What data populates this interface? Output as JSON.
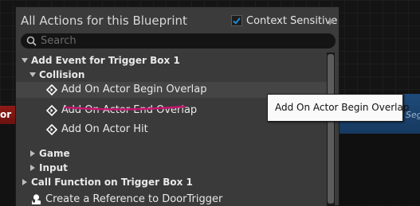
{
  "background_node_left": {
    "title": "or B"
  },
  "background_node_right": {
    "label": "Seg"
  },
  "menu": {
    "title": "All Actions for this Blueprint",
    "context_sensitive": {
      "label": "Context Sensitive",
      "checked": true
    },
    "search": {
      "placeholder": "Search",
      "value": ""
    },
    "tree": [
      {
        "kind": "category",
        "label": "Add Event for Trigger Box 1",
        "expanded": true,
        "level": 0
      },
      {
        "kind": "category",
        "label": "Collision",
        "expanded": true,
        "level": 1
      },
      {
        "kind": "event",
        "label": "Add On Actor Begin Overlap",
        "level": 2,
        "hovered": true
      },
      {
        "kind": "event",
        "label": "Add On Actor End Overlap",
        "level": 2
      },
      {
        "kind": "event",
        "label": "Add On Actor Hit",
        "level": 2
      },
      {
        "kind": "category",
        "label": "Game",
        "expanded": false,
        "level": 1
      },
      {
        "kind": "category",
        "label": "Input",
        "expanded": false,
        "level": 1
      },
      {
        "kind": "category",
        "label": "Call Function on Trigger Box 1",
        "expanded": false,
        "level": 0
      },
      {
        "kind": "action",
        "label": "Create a Reference to DoorTrigger",
        "level": 0
      }
    ]
  },
  "tooltip": {
    "text": "Add On Actor Begin Overlap"
  },
  "colors": {
    "annotation_underline": "#c4166e",
    "checkbox_check": "#1e8ad6",
    "node_red": "#8e1a16",
    "node_blue": "#1f4a7a"
  },
  "icons": {
    "search": "search-icon",
    "event": "event-diamond-icon",
    "reference": "blueprint-reference-icon",
    "checkbox": "checkmark-icon",
    "expand": "chevron-right-icon",
    "collapse": "chevron-down-icon"
  }
}
